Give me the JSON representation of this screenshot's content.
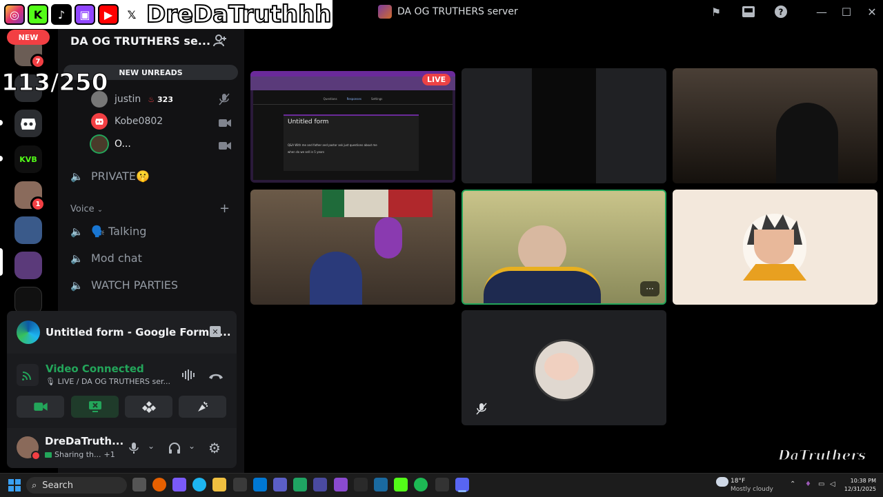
{
  "window": {
    "title": "DA OG TRUTHERS server",
    "controls": [
      "inbox-flag-icon",
      "inbox-icon",
      "help-icon",
      "minimize-icon",
      "maximize-icon",
      "close-icon"
    ]
  },
  "overlay": {
    "streamer_name": "DreDaTruthhh",
    "socials": [
      "instagram",
      "kick",
      "tiktok",
      "twitch",
      "youtube",
      "x"
    ],
    "viewer_counter": "113/250"
  },
  "rail": {
    "new_label": "NEW",
    "badges": [
      "7",
      "1"
    ],
    "kvb_label": "KVB"
  },
  "sidebar": {
    "guild_name": "DA OG TRUTHERS se...",
    "new_unreads": "NEW UNREADS",
    "voice_users": [
      {
        "name": "justin",
        "boost": "323"
      },
      {
        "name": "Kobe0802"
      },
      {
        "name": "O..."
      }
    ],
    "channels_top": [
      {
        "label": "PRIVATE🤫"
      }
    ],
    "voice_section": "Voice",
    "voice_channels": [
      {
        "label": "🗣️ Talking"
      },
      {
        "label": "Mod chat"
      },
      {
        "label": "WATCH PARTIES"
      }
    ]
  },
  "stream": {
    "title": "Untitled form - Google Forms ...",
    "status": "Video Connected",
    "sub": "LIVE / DA OG TRUTHERS ser...",
    "user_name": "DreDaTruth...",
    "user_status": "Sharing th...",
    "user_extra": "+1"
  },
  "grid": {
    "live_label": "LIVE",
    "form_title": "Untitled form",
    "form_tabs": [
      "Questions",
      "Responses",
      "Settings"
    ],
    "form_q1": "Q&A With me and father and pastor ask just questions about me",
    "form_q2": "when do we sell in 5 years",
    "more_label": "···"
  },
  "watermark": "DaTruthers",
  "taskbar": {
    "search": "Search",
    "weather_temp": "18°F",
    "weather_desc": "Mostly cloudy",
    "time": "10:38 PM",
    "date": "12/31/2025"
  },
  "colors": {
    "accent_green": "#23a55a",
    "live_red": "#ed4245",
    "sidebar_bg": "#121214",
    "card_bg": "#1e1f22"
  }
}
